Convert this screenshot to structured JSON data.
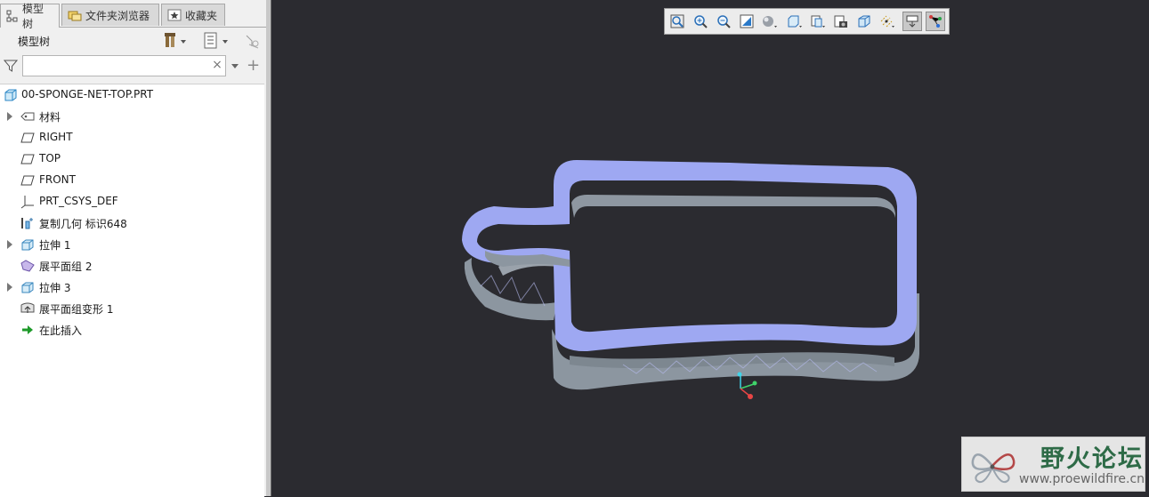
{
  "tabs": [
    {
      "label": "模型树",
      "icon": "model-tree-icon",
      "active": true
    },
    {
      "label": "文件夹浏览器",
      "icon": "folder-browser-icon",
      "active": false
    },
    {
      "label": "收藏夹",
      "icon": "favorites-icon",
      "active": false
    }
  ],
  "tree_toolbar": {
    "title": "模型树",
    "icons": [
      "settings-icon",
      "show-options-icon",
      "column-visibility-icon"
    ]
  },
  "filter": {
    "value": "",
    "placeholder": "",
    "clear_label": "×",
    "add_label": "+"
  },
  "tree": {
    "root": "00-SPONGE-NET-TOP.PRT",
    "items": [
      {
        "label": "材料",
        "icon": "material-icon",
        "expandable": true
      },
      {
        "label": "RIGHT",
        "icon": "datum-plane-icon",
        "expandable": false
      },
      {
        "label": "TOP",
        "icon": "datum-plane-icon",
        "expandable": false
      },
      {
        "label": "FRONT",
        "icon": "datum-plane-icon",
        "expandable": false
      },
      {
        "label": "PRT_CSYS_DEF",
        "icon": "csys-icon",
        "expandable": false
      },
      {
        "label": "复制几何 标识648",
        "icon": "copy-geometry-icon",
        "expandable": false
      },
      {
        "label": "拉伸 1",
        "icon": "extrude-icon",
        "expandable": true
      },
      {
        "label": "展平面组 2",
        "icon": "flatten-quilt-icon",
        "expandable": false
      },
      {
        "label": "拉伸 3",
        "icon": "extrude-icon",
        "expandable": true
      },
      {
        "label": "展平面组变形 1",
        "icon": "flatten-deform-icon",
        "expandable": false
      },
      {
        "label": "在此插入",
        "icon": "insert-here-arrow-icon",
        "expandable": false
      }
    ]
  },
  "view_toolbar": [
    "refit-icon",
    "zoom-in-icon",
    "zoom-out-icon",
    "repaint-icon",
    "display-style-icon",
    "named-views-icon",
    "saved-orientations-icon",
    "view-manager-icon",
    "perspective-icon",
    "datum-display-icon",
    "annotation-display-icon",
    "spin-center-icon"
  ],
  "watermark": {
    "title": "野火论坛",
    "url": "www.proewildfire.cn"
  },
  "colors": {
    "viewport_bg": "#2b2b30",
    "model_top": "#9ea8f2",
    "model_side": "#8f98a3",
    "panel_bg": "#f0f0f0"
  }
}
